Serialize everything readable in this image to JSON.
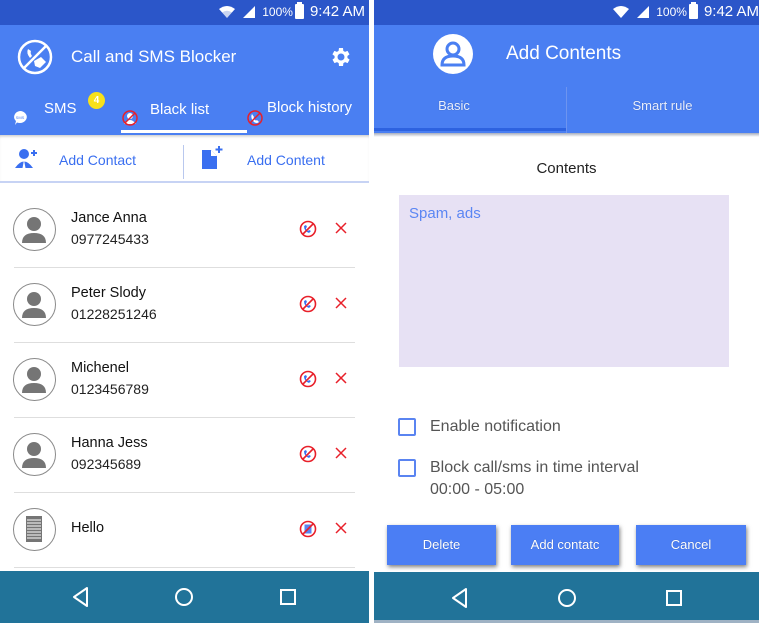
{
  "left_screen": {
    "status_bar": {
      "signal_percent": "100%",
      "time": "9:42 AM"
    },
    "app_bar": {
      "title": "Call and SMS Blocker",
      "logo_icon": "call-sms-blocked-icon",
      "settings_icon": "gear-icon"
    },
    "tabs": [
      {
        "label": "SMS",
        "icon": "sms-bubble-icon",
        "badge": "4",
        "active": false
      },
      {
        "label": "Black list",
        "icon": "blocked-person-icon",
        "active": true
      },
      {
        "label": "Block history",
        "icon": "blocked-call-icon",
        "active": false
      }
    ],
    "actions": {
      "add_contact": {
        "label": "Add Contact",
        "icon": "add-person-icon"
      },
      "add_content": {
        "label": "Add Content",
        "icon": "add-document-icon"
      }
    },
    "blacklist": [
      {
        "name": "Jance Anna",
        "phone": "0977245433",
        "type": "contact",
        "block_icon": "blocked-call-icon",
        "delete_icon": "close-icon"
      },
      {
        "name": "Peter Slody",
        "phone": "01228251246",
        "type": "contact",
        "block_icon": "blocked-call-icon",
        "delete_icon": "close-icon"
      },
      {
        "name": "Michenel",
        "phone": "0123456789",
        "type": "contact",
        "block_icon": "blocked-call-icon",
        "delete_icon": "close-icon"
      },
      {
        "name": "Hanna Jess",
        "phone": "092345689",
        "type": "contact",
        "block_icon": "blocked-call-icon",
        "delete_icon": "close-icon"
      },
      {
        "name": "Hello",
        "phone": "",
        "type": "content",
        "block_icon": "blocked-message-icon",
        "delete_icon": "close-icon"
      }
    ],
    "nav_bar": [
      "back-icon",
      "home-icon",
      "recents-icon"
    ]
  },
  "right_screen": {
    "status_bar": {
      "signal_percent": "100%",
      "time": "9:42 AM"
    },
    "app_bar": {
      "title": "Add Contents",
      "icon": "person-icon"
    },
    "tabs": [
      {
        "label": "Basic",
        "active": true
      },
      {
        "label": "Smart rule",
        "active": false
      }
    ],
    "form": {
      "contents_label": "Contents",
      "contents_value": "Spam, ads",
      "enable_notification": {
        "label": "Enable notification",
        "checked": false
      },
      "block_interval": {
        "label": "Block call/sms in time interval",
        "interval": "00:00 - 05:00",
        "checked": false
      }
    },
    "buttons": {
      "delete": "Delete",
      "add_contact": "Add contatc",
      "cancel": "Cancel"
    },
    "nav_bar": [
      "back-icon",
      "home-icon",
      "recents-icon"
    ]
  },
  "colors": {
    "status_bar": "#2b56c9",
    "primary": "#4a7ff2",
    "accent_text": "#3a6ff0",
    "badge": "#f7e11a",
    "delete_red": "#e8202a",
    "nav_bar": "#217399",
    "textarea_bg": "#e7e1f4"
  }
}
